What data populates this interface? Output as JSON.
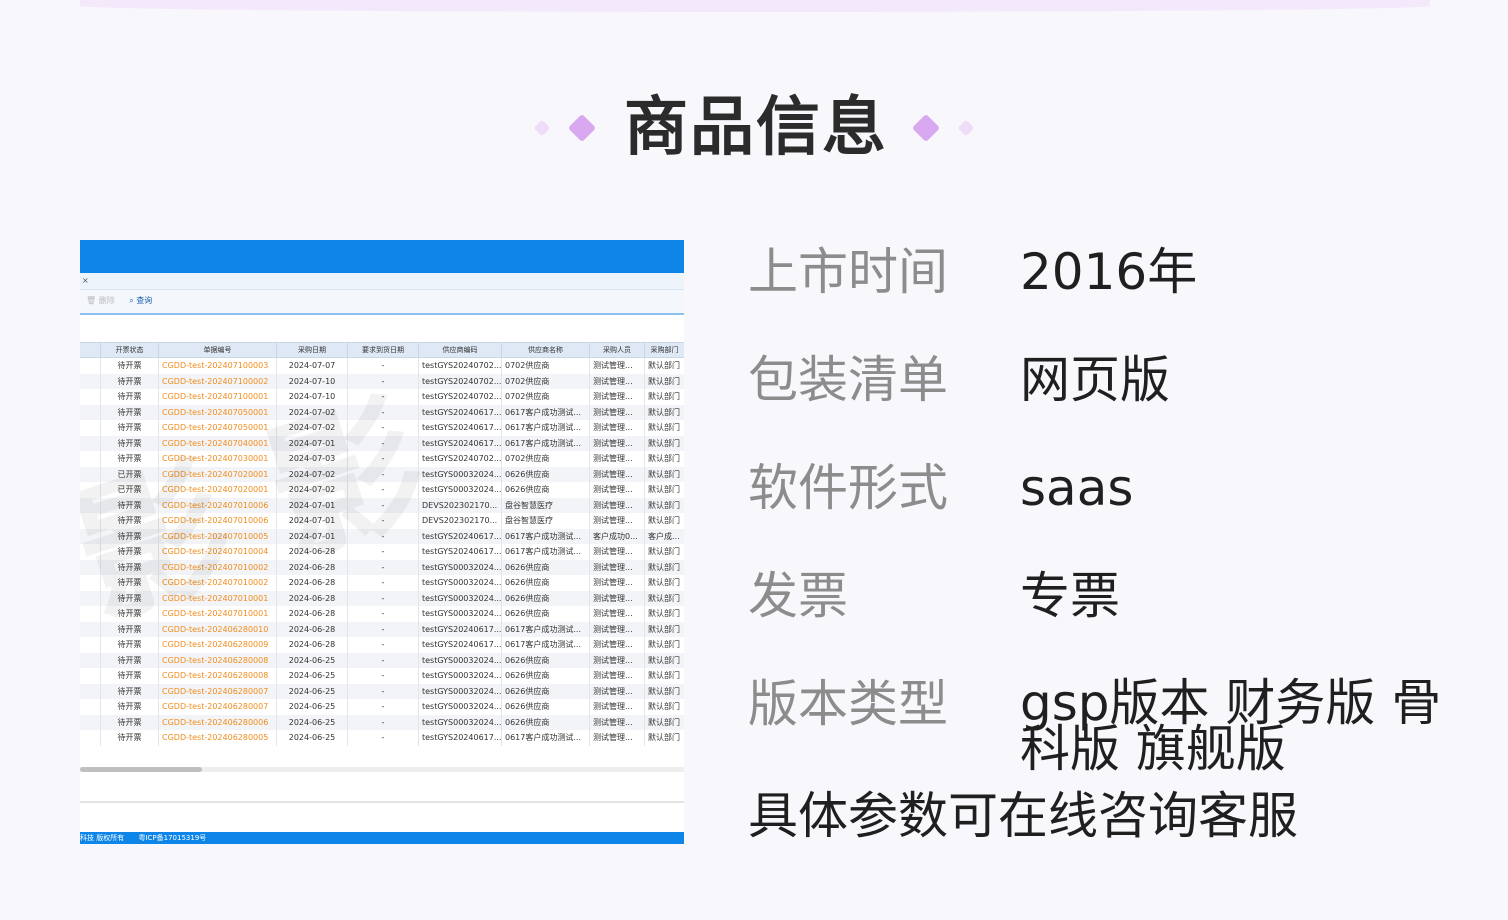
{
  "title": "商品信息",
  "colors": {
    "accent_purple": "#d8a8f0",
    "app_blue": "#0e85e8",
    "link_orange": "#f08c1c"
  },
  "specs": [
    {
      "label": "上市时间",
      "value": "2016年"
    },
    {
      "label": "包装清单",
      "value": "网页版"
    },
    {
      "label": "软件形式",
      "value": "saas"
    },
    {
      "label": "发票",
      "value": "专票"
    },
    {
      "label": "版本类型",
      "value": "gsp版本 财务版 骨科版 旗舰版"
    }
  ],
  "note": "具体参数可在线咨询客服",
  "screenshot": {
    "tab_close": "× ",
    "toolbar": {
      "delete_label": "删除",
      "query_label": "查询"
    },
    "columns": [
      "",
      "开票状态",
      "单据编号",
      "采购日期",
      "要求到货日期",
      "供应商编码",
      "供应商名称",
      "采购人员",
      "采购部门"
    ],
    "rows": [
      [
        "待开票",
        "CGDD-test-202407100003",
        "2024-07-07",
        "-",
        "testGYS20240702...",
        "0702供应商",
        "测试管理...",
        "默认部门"
      ],
      [
        "待开票",
        "CGDD-test-202407100002",
        "2024-07-10",
        "-",
        "testGYS20240702...",
        "0702供应商",
        "测试管理...",
        "默认部门"
      ],
      [
        "待开票",
        "CGDD-test-202407100001",
        "2024-07-10",
        "-",
        "testGYS20240702...",
        "0702供应商",
        "测试管理...",
        "默认部门"
      ],
      [
        "待开票",
        "CGDD-test-202407050001",
        "2024-07-02",
        "-",
        "testGYS20240617...",
        "0617客户成功测试...",
        "测试管理...",
        "默认部门"
      ],
      [
        "待开票",
        "CGDD-test-202407050001",
        "2024-07-02",
        "-",
        "testGYS20240617...",
        "0617客户成功测试...",
        "测试管理...",
        "默认部门"
      ],
      [
        "待开票",
        "CGDD-test-202407040001",
        "2024-07-01",
        "-",
        "testGYS20240617...",
        "0617客户成功测试...",
        "测试管理...",
        "默认部门"
      ],
      [
        "待开票",
        "CGDD-test-202407030001",
        "2024-07-03",
        "-",
        "testGYS20240702...",
        "0702供应商",
        "测试管理...",
        "默认部门"
      ],
      [
        "已开票",
        "CGDD-test-202407020001",
        "2024-07-02",
        "-",
        "testGYS00032024...",
        "0626供应商",
        "测试管理...",
        "默认部门"
      ],
      [
        "已开票",
        "CGDD-test-202407020001",
        "2024-07-02",
        "-",
        "testGYS00032024...",
        "0626供应商",
        "测试管理...",
        "默认部门"
      ],
      [
        "待开票",
        "CGDD-test-202407010006",
        "2024-07-01",
        "-",
        "DEVS202302170...",
        "盘谷智慧医疗",
        "测试管理...",
        "默认部门"
      ],
      [
        "待开票",
        "CGDD-test-202407010006",
        "2024-07-01",
        "-",
        "DEVS202302170...",
        "盘谷智慧医疗",
        "测试管理...",
        "默认部门"
      ],
      [
        "待开票",
        "CGDD-test-202407010005",
        "2024-07-01",
        "-",
        "testGYS20240617...",
        "0617客户成功测试...",
        "客户成功0...",
        "客户成..."
      ],
      [
        "待开票",
        "CGDD-test-202407010004",
        "2024-06-28",
        "-",
        "testGYS20240617...",
        "0617客户成功测试...",
        "测试管理...",
        "默认部门"
      ],
      [
        "待开票",
        "CGDD-test-202407010002",
        "2024-06-28",
        "-",
        "testGYS00032024...",
        "0626供应商",
        "测试管理...",
        "默认部门"
      ],
      [
        "待开票",
        "CGDD-test-202407010002",
        "2024-06-28",
        "-",
        "testGYS00032024...",
        "0626供应商",
        "测试管理...",
        "默认部门"
      ],
      [
        "待开票",
        "CGDD-test-202407010001",
        "2024-06-28",
        "-",
        "testGYS00032024...",
        "0626供应商",
        "测试管理...",
        "默认部门"
      ],
      [
        "待开票",
        "CGDD-test-202407010001",
        "2024-06-28",
        "-",
        "testGYS00032024...",
        "0626供应商",
        "测试管理...",
        "默认部门"
      ],
      [
        "待开票",
        "CGDD-test-202406280010",
        "2024-06-28",
        "-",
        "testGYS20240617...",
        "0617客户成功测试...",
        "测试管理...",
        "默认部门"
      ],
      [
        "待开票",
        "CGDD-test-202406280009",
        "2024-06-28",
        "-",
        "testGYS20240617...",
        "0617客户成功测试...",
        "测试管理...",
        "默认部门"
      ],
      [
        "待开票",
        "CGDD-test-202406280008",
        "2024-06-25",
        "-",
        "testGYS00032024...",
        "0626供应商",
        "测试管理...",
        "默认部门"
      ],
      [
        "待开票",
        "CGDD-test-202406280008",
        "2024-06-25",
        "-",
        "testGYS00032024...",
        "0626供应商",
        "测试管理...",
        "默认部门"
      ],
      [
        "待开票",
        "CGDD-test-202406280007",
        "2024-06-25",
        "-",
        "testGYS00032024...",
        "0626供应商",
        "测试管理...",
        "默认部门"
      ],
      [
        "待开票",
        "CGDD-test-202406280007",
        "2024-06-25",
        "-",
        "testGYS00032024...",
        "0626供应商",
        "测试管理...",
        "默认部门"
      ],
      [
        "待开票",
        "CGDD-test-202406280006",
        "2024-06-25",
        "-",
        "testGYS00032024...",
        "0626供应商",
        "测试管理...",
        "默认部门"
      ],
      [
        "待开票",
        "CGDD-test-202406280005",
        "2024-06-25",
        "-",
        "testGYS20240617...",
        "0617客户成功测试...",
        "测试管理...",
        "默认部门"
      ]
    ],
    "footer": {
      "copyright": "科技 版权所有",
      "icp": "粤ICP备17015319号"
    }
  }
}
